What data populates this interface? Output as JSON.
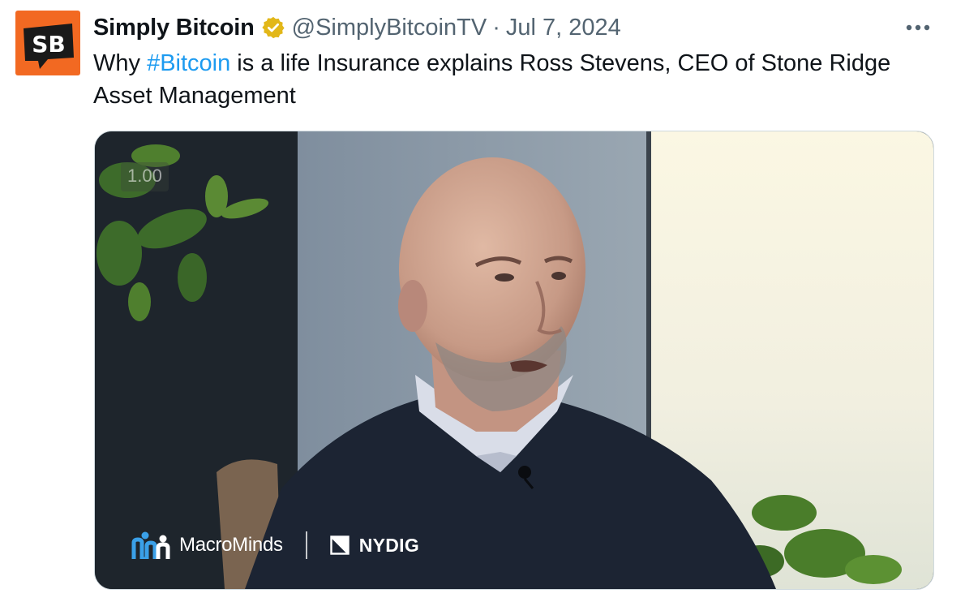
{
  "author": {
    "avatar_text": "SB",
    "name": "Simply Bitcoin",
    "handle": "@SimplyBitcoinTV",
    "separator": "·",
    "date": "Jul 7, 2024",
    "verified_badge": "gold-verified-badge-icon"
  },
  "more_icon": "more-horizontal-icon",
  "tweet": {
    "prefix": "Why ",
    "hashtag": "#Bitcoin",
    "suffix": " is a life Insurance explains Ross Stevens, CEO of Stone Ridge Asset Management"
  },
  "media": {
    "speed_label": "1.00",
    "watermark_left": "MacroMinds",
    "watermark_right": "NYDIG"
  },
  "colors": {
    "avatar_bg": "#f26922",
    "link": "#1d9bf0",
    "secondary_text": "#536471",
    "badge_gold": "#e2b719"
  }
}
